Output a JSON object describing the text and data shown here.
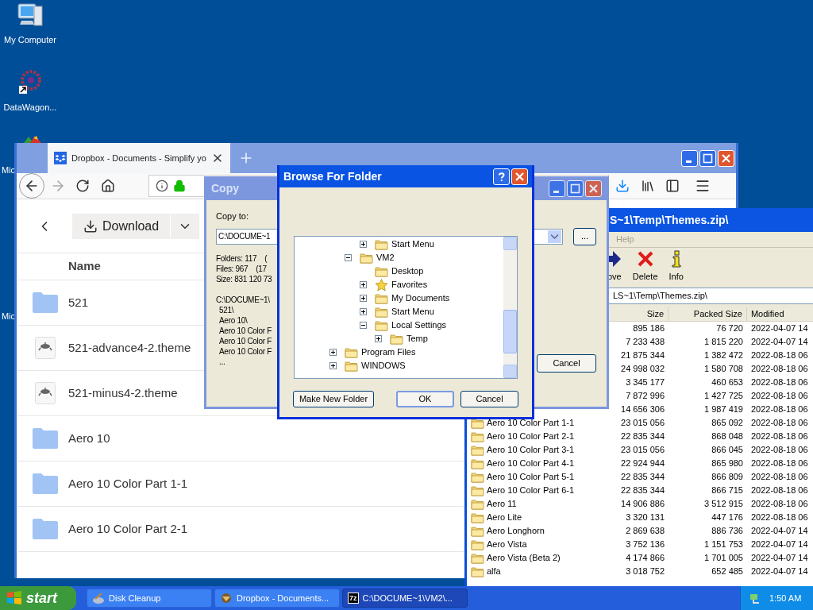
{
  "desktop_icons": [
    {
      "label": "My Computer",
      "kind": "computer"
    },
    {
      "label": "DataWagon...",
      "kind": "shortcut"
    },
    {
      "label": "Mic",
      "kind": "app"
    },
    {
      "label": "Mic",
      "kind": "hidden"
    }
  ],
  "browser": {
    "tab": {
      "title": "Dropbox - Documents - Simplify yo",
      "selected": true
    },
    "download_button": "Download",
    "column_header": "Name",
    "files": [
      {
        "name": "521",
        "kind": "folder"
      },
      {
        "name": "521-advance4-2.theme",
        "kind": "theme"
      },
      {
        "name": "521-minus4-2.theme",
        "kind": "theme"
      },
      {
        "name": "Aero 10",
        "kind": "folder"
      },
      {
        "name": "Aero 10 Color Part 1-1",
        "kind": "folder"
      },
      {
        "name": "Aero 10 Color Part 2-1",
        "kind": "folder"
      }
    ]
  },
  "archive_window": {
    "title": "S~1\\Temp\\Themes.zip\\",
    "menu": [
      "Help"
    ],
    "toolbar": [
      {
        "label": "ove",
        "kind": "move"
      },
      {
        "label": "Delete",
        "kind": "delete"
      },
      {
        "label": "Info",
        "kind": "info"
      }
    ],
    "address": "LS~1\\Temp\\Themes.zip\\",
    "columns": [
      "Size",
      "Packed Size",
      "Modified"
    ],
    "rows": [
      {
        "size": "895 186",
        "packed_size": "76 720",
        "modified": "2022-04-07 14"
      },
      {
        "size": "7 233 438",
        "packed_size": "1 815 220",
        "modified": "2022-04-07 14"
      },
      {
        "size": "21 875 344",
        "packed_size": "1 382 472",
        "modified": "2022-08-18 06"
      },
      {
        "size": "24 998 032",
        "packed_size": "1 580 708",
        "modified": "2022-08-18 06"
      },
      {
        "size": "3 345 177",
        "packed_size": "460 653",
        "modified": "2022-08-18 06"
      },
      {
        "size": "7 872 996",
        "packed_size": "1 427 725",
        "modified": "2022-08-18 06"
      },
      {
        "size": "14 656 306",
        "packed_size": "1 987 419",
        "modified": "2022-08-18 06"
      },
      {
        "name": "Aero 10 Color Part 1-1",
        "size": "23 015 056",
        "packed_size": "865 092",
        "modified": "2022-08-18 06"
      },
      {
        "name": "Aero 10 Color Part 2-1",
        "size": "22 835 344",
        "packed_size": "868 048",
        "modified": "2022-08-18 06"
      },
      {
        "name": "Aero 10 Color Part 3-1",
        "size": "23 015 056",
        "packed_size": "866 045",
        "modified": "2022-08-18 06"
      },
      {
        "name": "Aero 10 Color Part 4-1",
        "size": "22 924 944",
        "packed_size": "865 980",
        "modified": "2022-08-18 06"
      },
      {
        "name": "Aero 10 Color Part 5-1",
        "size": "22 835 344",
        "packed_size": "866 809",
        "modified": "2022-08-18 06"
      },
      {
        "name": "Aero 10 Color Part 6-1",
        "size": "22 835 344",
        "packed_size": "866 715",
        "modified": "2022-08-18 06"
      },
      {
        "name": "Aero 11",
        "size": "14 906 886",
        "packed_size": "3 512 915",
        "modified": "2022-08-18 06"
      },
      {
        "name": "Aero Lite",
        "size": "3 320 131",
        "packed_size": "447 176",
        "modified": "2022-08-18 06"
      },
      {
        "name": "Aero Longhorn",
        "size": "2 869 638",
        "packed_size": "886 736",
        "modified": "2022-04-07 14"
      },
      {
        "name": "Aero Vista",
        "size": "3 752 136",
        "packed_size": "1 151 753",
        "modified": "2022-04-07 14"
      },
      {
        "name": "Aero Vista (Beta 2)",
        "size": "4 174 866",
        "packed_size": "1 701 005",
        "modified": "2022-04-07 14"
      },
      {
        "name": "alfa",
        "size": "3 018 752",
        "packed_size": "652 485",
        "modified": "2022-04-07 14"
      }
    ]
  },
  "copy_dialog": {
    "title": "Copy",
    "copy_to_label": "Copy to:",
    "destination": "C:\\DOCUME~1",
    "stats": [
      "Folders: 117    (",
      "Files: 967    (17",
      "Size: 831 120 73"
    ],
    "source_path": "C:\\DOCUME~1\\",
    "source_items": [
      "521\\",
      "Aero 10\\",
      "Aero 10 Color F",
      "Aero 10 Color F",
      "Aero 10 Color F",
      "..."
    ],
    "browse_button": "...",
    "cancel_button": "Cancel"
  },
  "browse_dialog": {
    "title": "Browse For Folder",
    "tree": [
      {
        "children": [
          {
            "children": [
              {
                "label": "Start Menu",
                "kind": "folder",
                "expanded": false
              }
            ]
          },
          {
            "label": "VM2",
            "kind": "folder",
            "expanded": true,
            "children": [
              {
                "label": "Desktop",
                "kind": "folder"
              },
              {
                "label": "Favorites",
                "kind": "star",
                "expanded": false
              },
              {
                "label": "My Documents",
                "kind": "folder",
                "expanded": false
              },
              {
                "label": "Start Menu",
                "kind": "folder",
                "expanded": false
              },
              {
                "label": "Local Settings",
                "kind": "folder",
                "expanded": true,
                "children": [
                  {
                    "label": "Temp",
                    "kind": "folder",
                    "expanded": false
                  }
                ]
              }
            ]
          }
        ]
      },
      {
        "label": "Program Files",
        "kind": "folder",
        "expanded": false
      },
      {
        "label": "WINDOWS",
        "kind": "folder",
        "expanded": false
      }
    ],
    "buttons": [
      {
        "label": "Make New Folder",
        "kind": "new"
      },
      {
        "label": "OK",
        "kind": "default"
      },
      {
        "label": "Cancel",
        "kind": "cancel"
      }
    ]
  },
  "taskbar": {
    "start_button": "start",
    "tasks": [
      {
        "label": "Disk Cleanup",
        "kind": "cleanup",
        "selected": false
      },
      {
        "label": "Dropbox - Documents...",
        "kind": "browser",
        "selected": false
      },
      {
        "label": "C:\\DOCUME~1\\VM2\\...",
        "kind": "archive",
        "badge": "7z",
        "selected": true
      }
    ],
    "clock": "1:50 AM"
  }
}
